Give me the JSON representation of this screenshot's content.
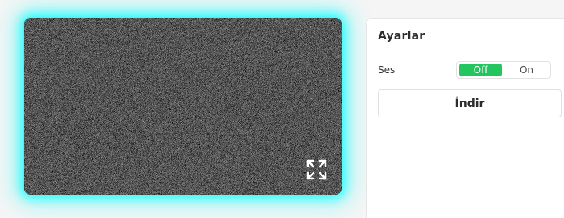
{
  "settings": {
    "title": "Ayarlar",
    "sound_label": "Ses",
    "sound_toggle": {
      "off_label": "Off",
      "on_label": "On",
      "selected": "Off"
    },
    "download_label": "İndir"
  },
  "icons": {
    "fullscreen": "expand-icon"
  },
  "colors": {
    "accent": "#22c55e",
    "glow": "#00ffff",
    "panel_bg": "#ffffff",
    "page_bg": "#f5f5f5"
  }
}
